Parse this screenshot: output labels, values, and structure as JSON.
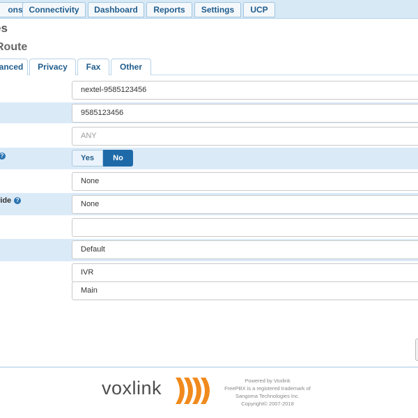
{
  "nav": {
    "items": [
      "ons",
      "Connectivity",
      "Dashboard",
      "Reports",
      "Settings",
      "UCP"
    ]
  },
  "header": {
    "title": "es",
    "subtitle": "Route"
  },
  "tabs": [
    "anced",
    "Privacy",
    "Fax",
    "Other"
  ],
  "form": {
    "description": "nextel-9585123456",
    "did_number": "9585123456",
    "cid_placeholder": "ANY",
    "yes_label": "Yes",
    "no_label": "No",
    "select_one": "None",
    "override_label": "ride",
    "select_two": "None",
    "empty_field": "",
    "select_default": "Default",
    "destination_type": "IVR",
    "destination_value": "Main"
  },
  "footer": {
    "brand": "voxlink",
    "powered": "Powered by Voxlink",
    "trademark1": "FreePBX is a registered trademark of",
    "trademark2": "Sangoma Technologies Inc.",
    "copyright": "Copyright© 2007-2018"
  },
  "colors": {
    "accent": "#1e6aa8",
    "highlight_row": "#dbeaf7",
    "brand_orange": "#f08a1c"
  }
}
